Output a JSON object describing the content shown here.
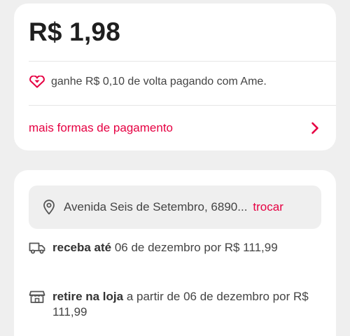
{
  "payment_card": {
    "price": "R$ 1,98",
    "cashback_text": "ganhe R$ 0,10 de volta pagando com Ame.",
    "more_payment_label": "mais formas de pagamento"
  },
  "delivery_card": {
    "address": "Avenida Seis de Setembro, 6890...",
    "change_label": "trocar",
    "delivery_option": {
      "bold": "receba até",
      "rest": " 06 de dezembro por R$ 111,99"
    },
    "pickup_option": {
      "bold": "retire na loja",
      "rest": " a partir de 06 de dezembro por R$ 111,99"
    }
  },
  "colors": {
    "accent": "#e60042",
    "background": "#efefef",
    "card": "#ffffff"
  },
  "icons": [
    "heart-diamond-icon",
    "chevron-right-icon",
    "map-pin-icon",
    "truck-icon",
    "store-icon"
  ]
}
